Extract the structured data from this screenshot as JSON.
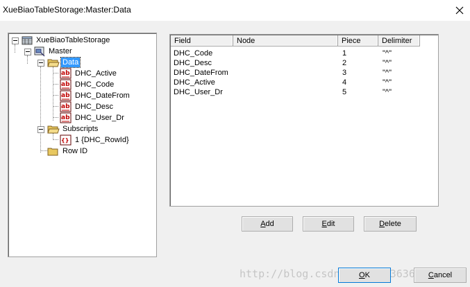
{
  "window": {
    "title": "XueBiaoTableStorage:Master:Data"
  },
  "tree": {
    "root": "XueBiaoTableStorage",
    "master": "Master",
    "data": "Data",
    "fields": [
      "DHC_Active",
      "DHC_Code",
      "DHC_DateFrom",
      "DHC_Desc",
      "DHC_User_Dr"
    ],
    "subscripts": "Subscripts",
    "subscript_item": "1  {DHC_RowId}",
    "rowid": "Row ID"
  },
  "grid": {
    "columns": [
      "Field",
      "Node",
      "Piece",
      "Delimiter"
    ],
    "rows": [
      {
        "field": "DHC_Code",
        "node": "",
        "piece": "1",
        "delimiter": "\"^\""
      },
      {
        "field": "DHC_Desc",
        "node": "",
        "piece": "2",
        "delimiter": "\"^\""
      },
      {
        "field": "DHC_DateFrom",
        "node": "",
        "piece": "3",
        "delimiter": "\"^\""
      },
      {
        "field": "DHC_Active",
        "node": "",
        "piece": "4",
        "delimiter": "\"^\""
      },
      {
        "field": "DHC_User_Dr",
        "node": "",
        "piece": "5",
        "delimiter": "\"^\""
      }
    ]
  },
  "buttons": {
    "add": {
      "hot": "A",
      "rest": "dd"
    },
    "edit": {
      "hot": "E",
      "rest": "dit"
    },
    "delete": {
      "hot": "D",
      "rest": "elete"
    },
    "ok": {
      "hot": "O",
      "rest": "K"
    },
    "cancel": {
      "pre": "",
      "hot": "C",
      "rest": "ancel"
    }
  },
  "watermark": "http://blog.csdn.net/qq_36361038",
  "colors": {
    "selection": "#3399ff",
    "folder": "#e8c860",
    "field_icon": "#c00000"
  }
}
